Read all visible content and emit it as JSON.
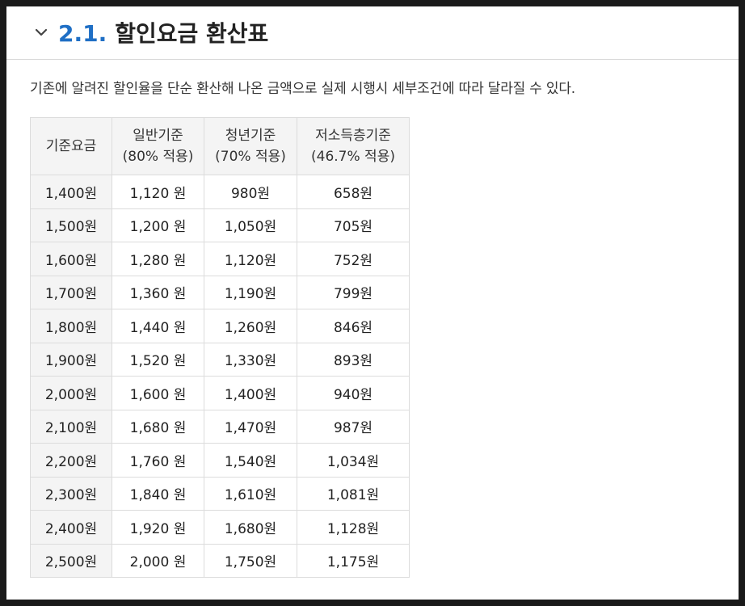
{
  "section": {
    "number": "2.1.",
    "title": "할인요금 환산표",
    "toggle_icon": "chevron-down-icon"
  },
  "description": "기존에 알려진 할인율을 단순 환산해 나온 금액으로 실제 시행시 세부조건에 따라 달라질 수 있다.",
  "table": {
    "headers": [
      {
        "line1": "기준요금",
        "line2": ""
      },
      {
        "line1": "일반기준",
        "line2": "(80% 적용)"
      },
      {
        "line1": "청년기준",
        "line2": "(70% 적용)"
      },
      {
        "line1": "저소득층기준",
        "line2": "(46.7% 적용)"
      }
    ],
    "rows": [
      [
        "1,400원",
        "1,120 원",
        "980원",
        "658원"
      ],
      [
        "1,500원",
        "1,200 원",
        "1,050원",
        "705원"
      ],
      [
        "1,600원",
        "1,280 원",
        "1,120원",
        "752원"
      ],
      [
        "1,700원",
        "1,360 원",
        "1,190원",
        "799원"
      ],
      [
        "1,800원",
        "1,440 원",
        "1,260원",
        "846원"
      ],
      [
        "1,900원",
        "1,520 원",
        "1,330원",
        "893원"
      ],
      [
        "2,000원",
        "1,600 원",
        "1,400원",
        "940원"
      ],
      [
        "2,100원",
        "1,680 원",
        "1,470원",
        "987원"
      ],
      [
        "2,200원",
        "1,760 원",
        "1,540원",
        "1,034원"
      ],
      [
        "2,300원",
        "1,840 원",
        "1,610원",
        "1,081원"
      ],
      [
        "2,400원",
        "1,920 원",
        "1,680원",
        "1,128원"
      ],
      [
        "2,500원",
        "2,000 원",
        "1,750원",
        "1,175원"
      ]
    ]
  },
  "colors": {
    "section_number": "#1f6fc5",
    "header_background": "#f4f4f4",
    "border": "#dcdcdc",
    "frame": "#1a1a1a"
  }
}
